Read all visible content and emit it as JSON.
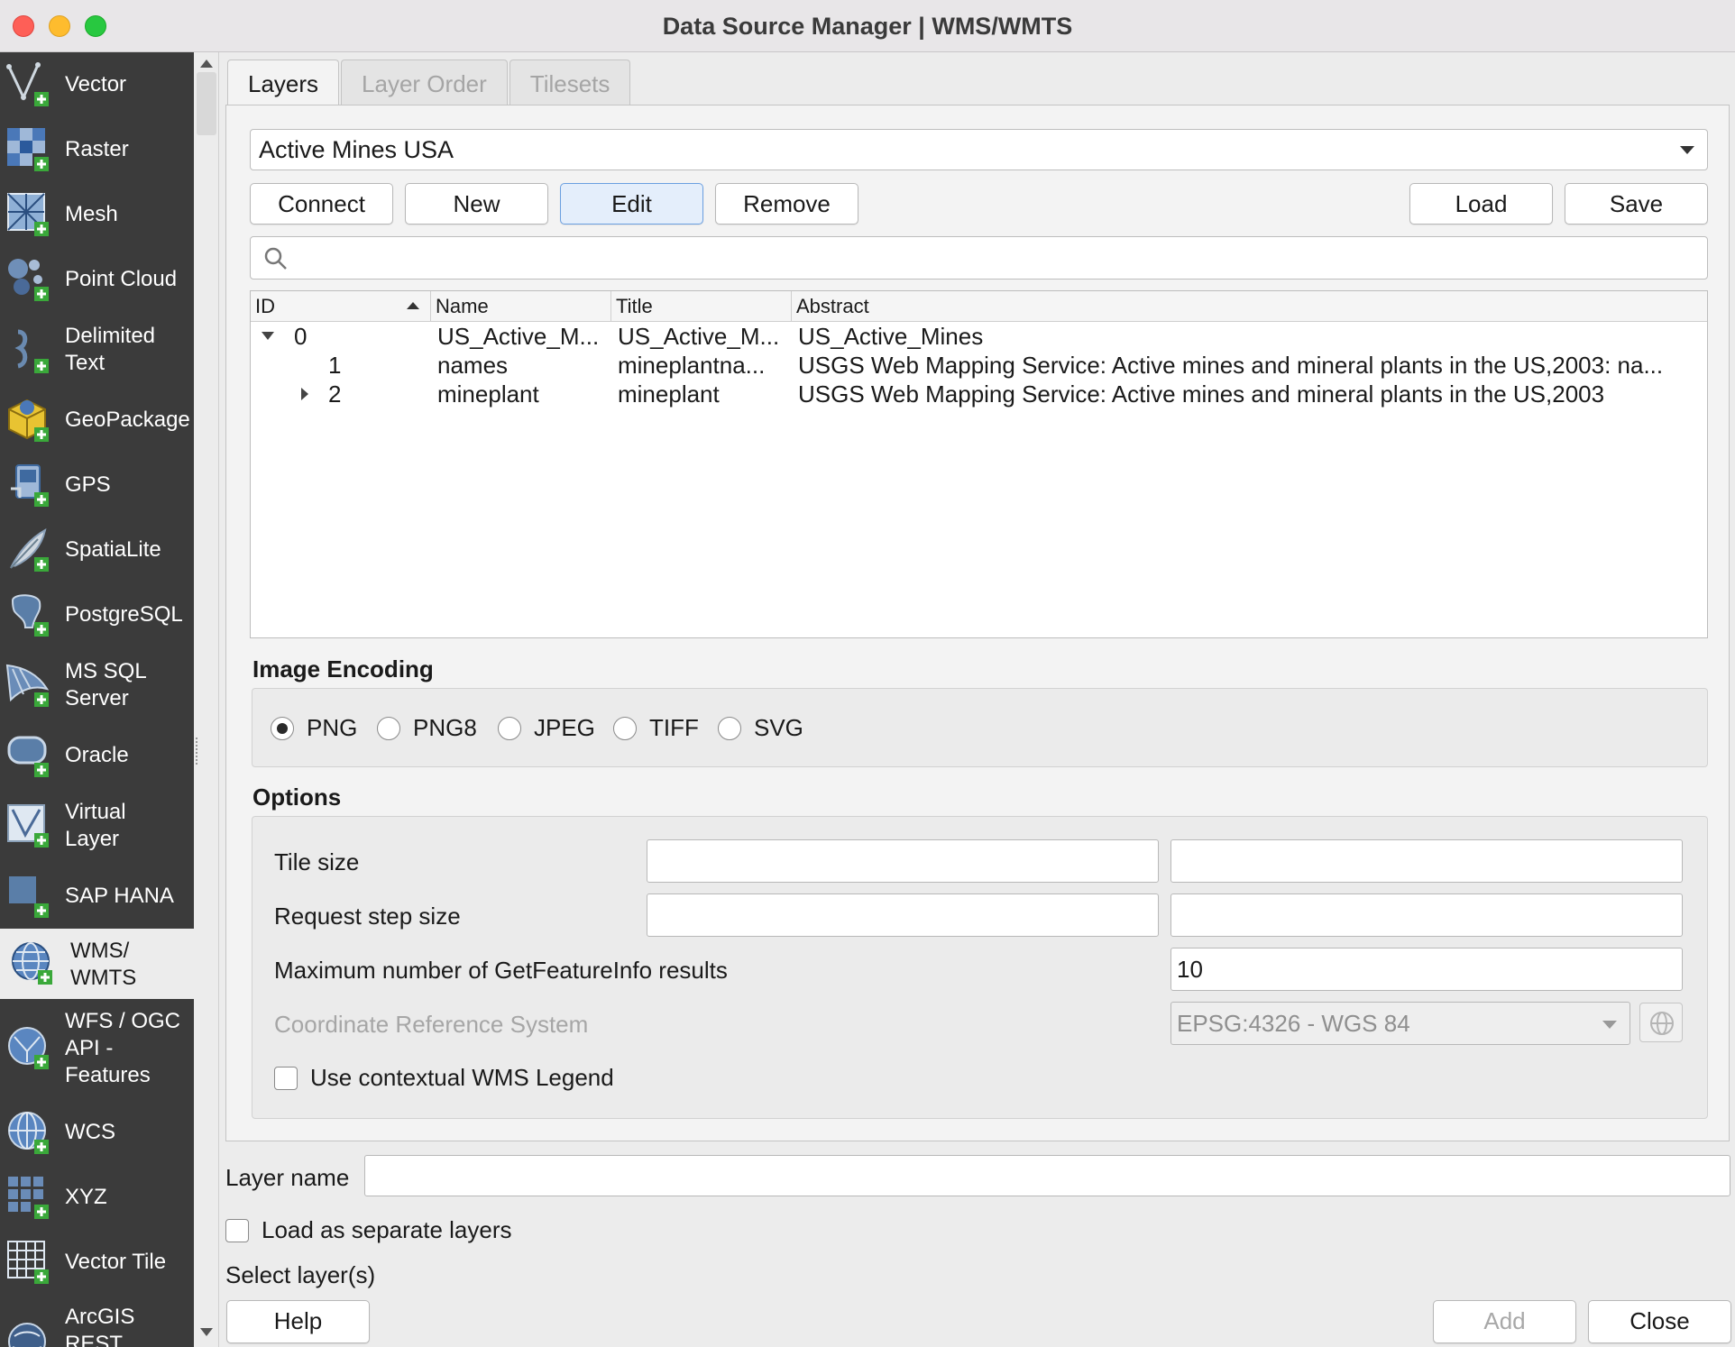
{
  "window": {
    "title": "Data Source Manager | WMS/WMTS"
  },
  "sidebar": {
    "items": [
      {
        "label": "Vector",
        "icon": "vector-layer-icon"
      },
      {
        "label": "Raster",
        "icon": "raster-layer-icon"
      },
      {
        "label": "Mesh",
        "icon": "mesh-layer-icon"
      },
      {
        "label": "Point Cloud",
        "icon": "point-cloud-icon"
      },
      {
        "label": "Delimited\nText",
        "icon": "delimited-text-icon"
      },
      {
        "label": "GeoPackage",
        "icon": "geopackage-icon"
      },
      {
        "label": "GPS",
        "icon": "gps-icon"
      },
      {
        "label": "SpatiaLite",
        "icon": "spatialite-icon"
      },
      {
        "label": "PostgreSQL",
        "icon": "postgresql-icon"
      },
      {
        "label": "MS SQL\nServer",
        "icon": "mssql-icon"
      },
      {
        "label": "Oracle",
        "icon": "oracle-icon"
      },
      {
        "label": "Virtual\nLayer",
        "icon": "virtual-layer-icon"
      },
      {
        "label": "SAP HANA",
        "icon": "sap-hana-icon"
      },
      {
        "label": "WMS/\nWMTS",
        "icon": "wms-icon",
        "selected": true
      },
      {
        "label": "WFS / OGC\nAPI -\nFeatures",
        "icon": "wfs-icon"
      },
      {
        "label": "WCS",
        "icon": "wcs-icon"
      },
      {
        "label": "XYZ",
        "icon": "xyz-icon"
      },
      {
        "label": "Vector Tile",
        "icon": "vector-tile-icon"
      },
      {
        "label": "ArcGIS\nREST\nServer",
        "icon": "arcgis-rest-icon"
      }
    ]
  },
  "tabs": [
    {
      "label": "Layers",
      "active": true
    },
    {
      "label": "Layer Order",
      "active": false
    },
    {
      "label": "Tilesets",
      "active": false
    }
  ],
  "connection": {
    "selected": "Active Mines USA"
  },
  "buttons": {
    "connect": "Connect",
    "new": "New",
    "edit": "Edit",
    "remove": "Remove",
    "load": "Load",
    "save": "Save",
    "help": "Help",
    "add": "Add",
    "close": "Close"
  },
  "search": {
    "placeholder": ""
  },
  "layer_table": {
    "columns": [
      "ID",
      "Name",
      "Title",
      "Abstract"
    ],
    "rows": [
      {
        "id": "0",
        "name": "US_Active_M...",
        "title": "US_Active_M...",
        "abstract": "US_Active_Mines",
        "expander": "open"
      },
      {
        "id": "1",
        "name": "names",
        "title": "mineplantna...",
        "abstract": "USGS Web Mapping Service: Active mines and mineral plants in the US,2003: na...",
        "expander": "none"
      },
      {
        "id": "2",
        "name": "mineplant",
        "title": "mineplant",
        "abstract": "USGS Web Mapping Service: Active mines and mineral plants in the US,2003",
        "expander": "closed"
      }
    ]
  },
  "image_encoding": {
    "title": "Image Encoding",
    "options": [
      "PNG",
      "PNG8",
      "JPEG",
      "TIFF",
      "SVG"
    ],
    "selected": "PNG"
  },
  "options": {
    "title": "Options",
    "tile_size_label": "Tile size",
    "request_step_label": "Request step size",
    "max_results_label": "Maximum number of GetFeatureInfo results",
    "max_results_value": "10",
    "crs_label": "Coordinate Reference System",
    "crs_value": "EPSG:4326 - WGS 84",
    "contextual_legend_label": "Use contextual WMS Legend"
  },
  "bottom": {
    "layer_name_label": "Layer name",
    "layer_name_value": "",
    "separate_layers_label": "Load as separate layers",
    "status": "Select layer(s)"
  }
}
